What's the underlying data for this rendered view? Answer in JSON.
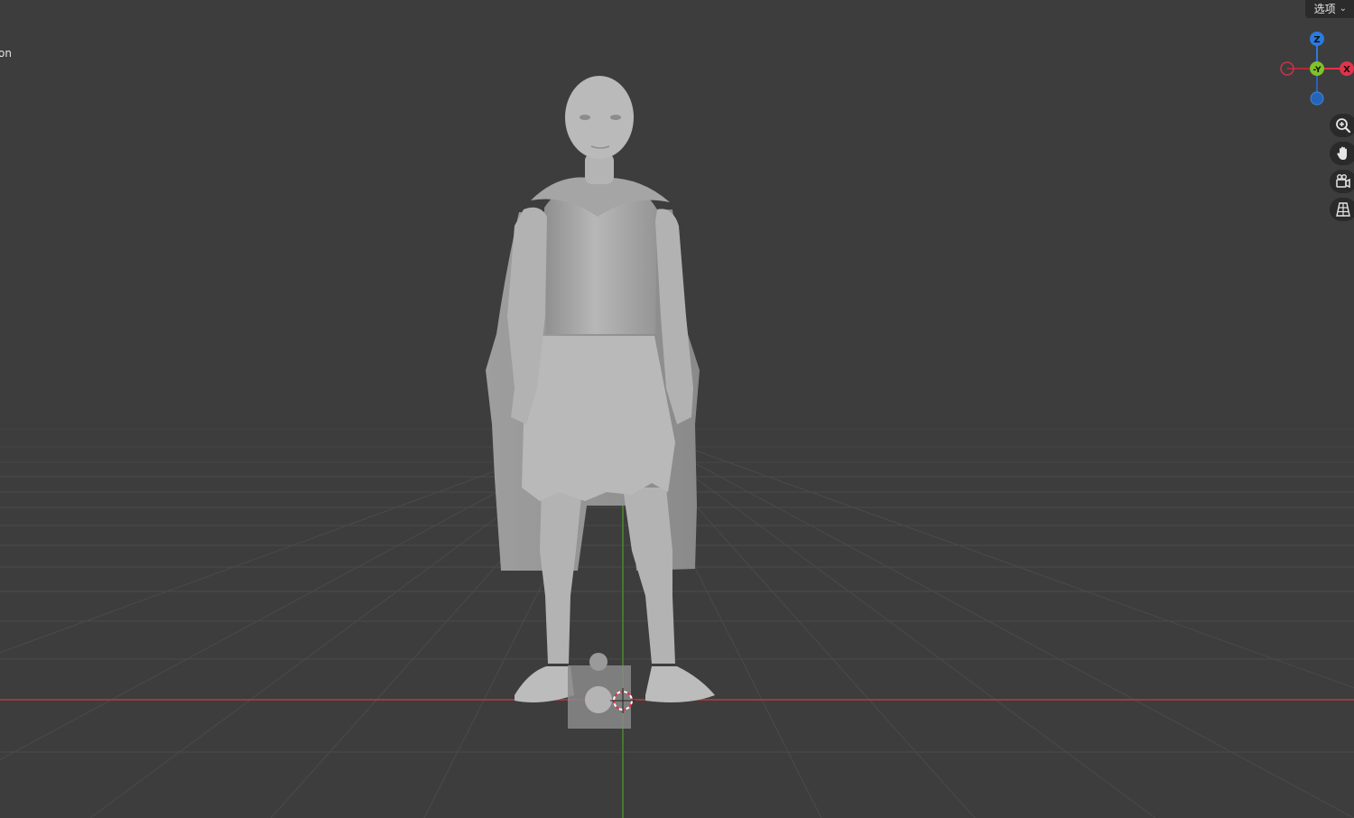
{
  "viewport": {
    "mode_label": "on",
    "options_label": "选项"
  },
  "gizmo": {
    "z_label": "Z",
    "y_label": "-Y",
    "x_label": "X",
    "colors": {
      "x": "#e0344a",
      "y": "#7fc229",
      "z": "#2a7be0",
      "neg_x": "#b3283b",
      "neg_z": "#2664b8"
    }
  },
  "nav_tools": [
    {
      "name": "zoom-icon"
    },
    {
      "name": "hand-pan-icon"
    },
    {
      "name": "camera-view-icon"
    },
    {
      "name": "perspective-grid-icon"
    }
  ],
  "scene": {
    "x_axis_color": "#b83a45",
    "y_axis_color": "#4c8a2e",
    "grid_color": "#4a4a4a",
    "model_color": "#a8a8a8"
  }
}
